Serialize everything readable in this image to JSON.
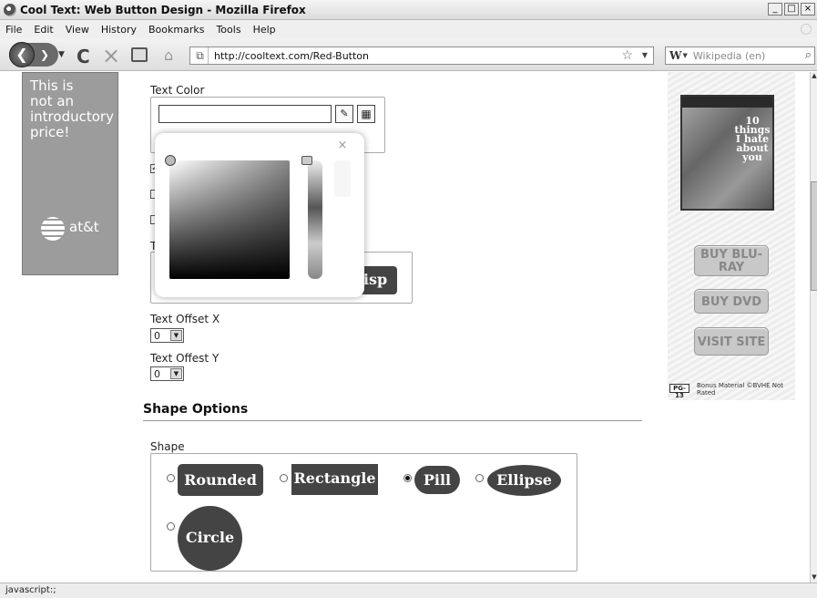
{
  "window": {
    "title": "Cool Text: Web Button Design - Mozilla Firefox",
    "controls": [
      "_",
      "□",
      "×"
    ]
  },
  "menu": [
    "File",
    "Edit",
    "View",
    "History",
    "Bookmarks",
    "Tools",
    "Help"
  ],
  "nav": {
    "url": "http://cooltext.com/Red-Button",
    "search_engine": "W",
    "search_placeholder": "Wikipedia (en)"
  },
  "ad_left": {
    "lines": [
      "This is",
      "not an",
      "introductory",
      "price!"
    ],
    "brand": "at&t"
  },
  "form": {
    "text_color_label": "Text Color",
    "truncated_label": "T",
    "preview_text": "isp",
    "offset_x_label": "Text Offset X",
    "offset_x_value": "0",
    "offset_y_label": "Text Offest Y",
    "offset_y_value": "0"
  },
  "shape_section": {
    "title": "Shape Options",
    "shape_label": "Shape",
    "options": [
      {
        "label": "Rounded",
        "selected": false
      },
      {
        "label": "Rectangle",
        "selected": false
      },
      {
        "label": "Pill",
        "selected": true
      },
      {
        "label": "Ellipse",
        "selected": false
      },
      {
        "label": "Circle",
        "selected": false
      }
    ]
  },
  "ad_right": {
    "dvd_title": "10 things I hate about you",
    "buttons": [
      "BUY BLU-RAY",
      "BUY DVD",
      "VISIT SITE"
    ],
    "rating": "PG-13",
    "rating_note": "Bonus Material ©BVHE Not Rated"
  },
  "status": "javascript:;",
  "icons": {
    "back": "❮",
    "forward": "❯",
    "reload": "C",
    "stop": "×",
    "home": "⌂",
    "page": "⧉",
    "star": "☆",
    "search": "⌕",
    "eyedropper": "✎",
    "grid": "▦",
    "close": "×",
    "checkmark": "✓"
  }
}
